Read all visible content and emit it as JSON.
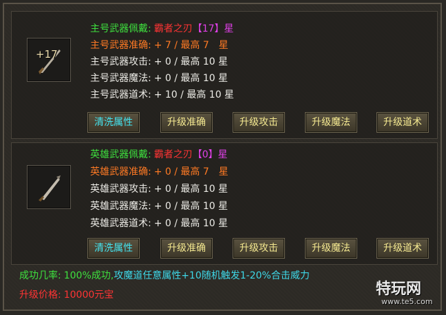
{
  "main": {
    "slot_level": "+17",
    "lines": [
      {
        "label": "主号武器佩戴:",
        "value": "霸者之刃",
        "extra": "【17】",
        "extra2": "星"
      },
      {
        "label": "主号武器准确:",
        "value": "+ 7 / 最高 7　星"
      },
      {
        "label": "主号武器攻击:",
        "value": "+ 0 / 最高 10 星"
      },
      {
        "label": "主号武器魔法:",
        "value": "+ 0 / 最高 10 星"
      },
      {
        "label": "主号武器道术:",
        "value": "+ 10 / 最高 10 星"
      }
    ],
    "buttons": [
      "清洗属性",
      "升级准确",
      "升级攻击",
      "升级魔法",
      "升级道术"
    ]
  },
  "hero": {
    "lines": [
      {
        "label": "英雄武器佩戴:",
        "value": "霸者之刃",
        "extra": "【0】",
        "extra2": "星"
      },
      {
        "label": "英雄武器准确:",
        "value": "+ 0 / 最高 7　星"
      },
      {
        "label": "英雄武器攻击:",
        "value": "+ 0 / 最高 10 星"
      },
      {
        "label": "英雄武器魔法:",
        "value": "+ 0 / 最高 10 星"
      },
      {
        "label": "英雄武器道术:",
        "value": "+ 0 / 最高 10 星"
      }
    ],
    "buttons": [
      "清洗属性",
      "升级准确",
      "升级攻击",
      "升级魔法",
      "升级道术"
    ]
  },
  "footer": {
    "rate_label": "成功几率:",
    "rate_value": "100%成功,",
    "rate_desc": "攻魔道任意属性+10随机触发1-20%合击威力",
    "price_label": "升级价格:",
    "price_value": "10000元宝"
  },
  "watermark": {
    "brand": "特玩网",
    "url": "www.te5.com"
  },
  "colors": {
    "label_green": "#3ee03e",
    "label_orange": "#ff7a24",
    "item_red": "#ff3434",
    "star_purple": "#e040e8",
    "button_text": "#f4e890",
    "wash_button_text": "#44e4f0"
  }
}
